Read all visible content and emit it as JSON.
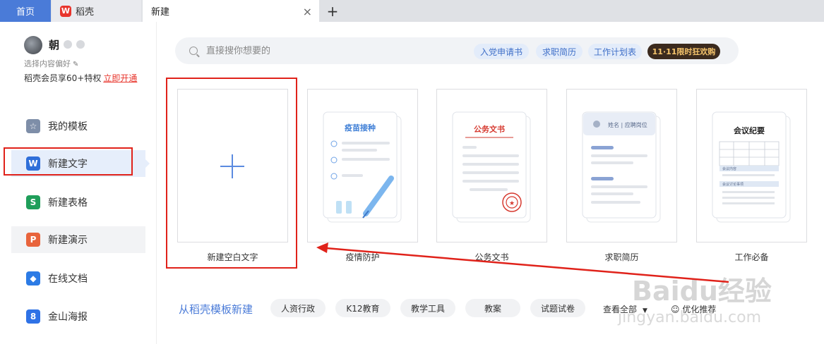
{
  "tabs": {
    "home": "首页",
    "docer": "稻壳",
    "docer_logo": "W",
    "new": "新建",
    "close": "×",
    "add": "+"
  },
  "user": {
    "name": "朝",
    "pref": "选择内容偏好",
    "vip_text": "稻壳会员享60+特权",
    "vip_link": "立即开通"
  },
  "sidebar": {
    "items": [
      {
        "label": "我的模板",
        "icon": "star-icon",
        "color": "#7e8ea8",
        "glyph": "☆"
      },
      {
        "label": "新建文字",
        "icon": "writer-icon",
        "color": "#2f6fd9",
        "glyph": "W"
      },
      {
        "label": "新建表格",
        "icon": "spreadsheet-icon",
        "color": "#1f9e5a",
        "glyph": "S"
      },
      {
        "label": "新建演示",
        "icon": "presentation-icon",
        "color": "#e8643c",
        "glyph": "P"
      },
      {
        "label": "在线文档",
        "icon": "cloud-doc-icon",
        "color": "#2c7be5",
        "glyph": "◆"
      },
      {
        "label": "金山海报",
        "icon": "poster-icon",
        "color": "#2f72e6",
        "glyph": "8"
      }
    ]
  },
  "search": {
    "placeholder": "直接搜你想要的",
    "chips": [
      "入党申请书",
      "求职简历",
      "工作计划表"
    ],
    "promo": "11·11限时狂欢购"
  },
  "cards": [
    {
      "label": "新建空白文字"
    },
    {
      "label": "疫情防护",
      "title": "疫苗接种"
    },
    {
      "label": "公务文书",
      "title": "公务文书"
    },
    {
      "label": "求职简历",
      "title": "姓名 | 应聘岗位"
    },
    {
      "label": "工作必备",
      "title": "会议纪要",
      "rows": [
        "会议内容",
        "会议讨论事项"
      ]
    }
  ],
  "templates": {
    "title": "从稻壳模板新建",
    "tags": [
      "人资行政",
      "K12教育",
      "教学工具",
      "教案",
      "试题试卷"
    ],
    "more": "查看全部",
    "recommend": "优化推荐"
  },
  "watermark": {
    "main": "Baidu经验",
    "sub": "jingyan.baidu.com"
  },
  "colors": {
    "accent": "#4a7bd8",
    "highlight_red": "#e0221a"
  }
}
